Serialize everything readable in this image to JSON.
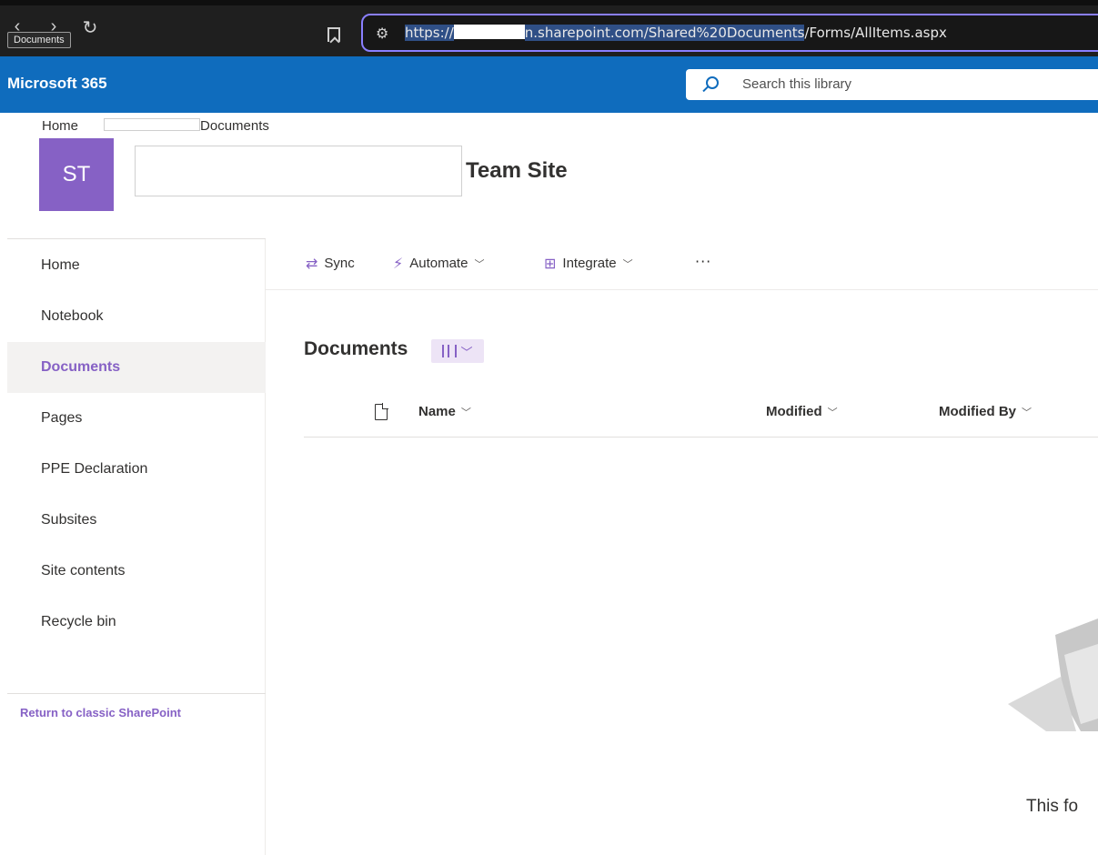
{
  "browser": {
    "tooltip": "Documents",
    "url_prefix": "https://",
    "url_middle": "n.sharepoint.com/Shared%20Documents",
    "url_suffix": "/Forms/AllItems.aspx"
  },
  "header": {
    "app_name": "Microsoft 365",
    "search_placeholder": "Search this library"
  },
  "site": {
    "breadcrumb_home": "Home",
    "breadcrumb_current": "Documents",
    "logo_initials": "ST",
    "logo_color": "#8661c5",
    "name": "Team Site"
  },
  "nav": {
    "items": [
      {
        "label": "Home"
      },
      {
        "label": "Notebook"
      },
      {
        "label": "Documents"
      },
      {
        "label": "Pages"
      },
      {
        "label": "PPE Declaration"
      },
      {
        "label": "Subsites"
      },
      {
        "label": "Site contents"
      },
      {
        "label": "Recycle bin"
      }
    ],
    "active": "Documents",
    "classic_link": "Return to classic SharePoint"
  },
  "command_bar": {
    "sync": "Sync",
    "automate": "Automate",
    "integrate": "Integrate",
    "more": "···"
  },
  "library": {
    "title": "Documents",
    "columns": [
      "Name",
      "Modified",
      "Modified By"
    ],
    "empty_text": "This fo"
  },
  "colors": {
    "header_blue": "#0f6cbd",
    "accent_purple": "#8661c5"
  }
}
